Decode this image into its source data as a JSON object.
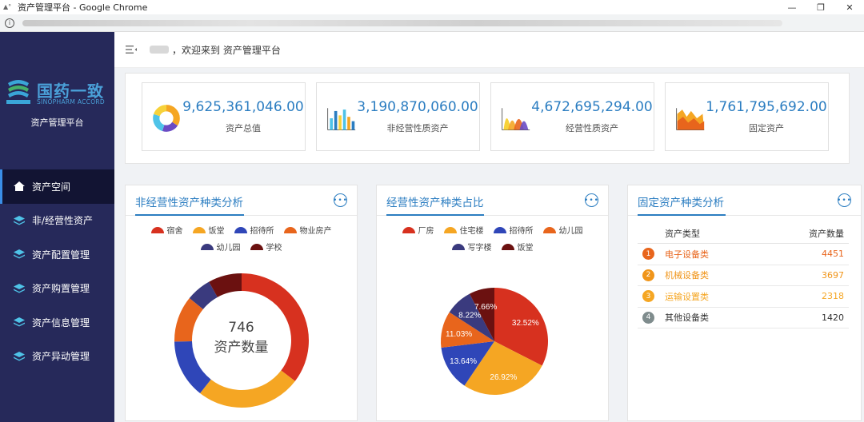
{
  "window": {
    "title": "资产管理平台 - Google Chrome",
    "minimize": "—",
    "restore": "❐",
    "close": "✕"
  },
  "header": {
    "welcome": "，欢迎来到 资产管理平台"
  },
  "brand": {
    "logo_cn": "国药一致",
    "logo_en": "SINOPHARM ACCORD",
    "platform_title": "资产管理平台"
  },
  "sidebar": {
    "items": [
      {
        "label": "资产空间",
        "icon": "home-icon",
        "active": true
      },
      {
        "label": "非/经营性资产",
        "icon": "stack-icon"
      },
      {
        "label": "资产配置管理",
        "icon": "stack-icon"
      },
      {
        "label": "资产购置管理",
        "icon": "stack-icon"
      },
      {
        "label": "资产信息管理",
        "icon": "stack-icon"
      },
      {
        "label": "资产异动管理",
        "icon": "stack-icon"
      }
    ]
  },
  "stats": [
    {
      "value": "9,625,361,046.00",
      "label": "资产总值",
      "icon": "donut-chart-icon"
    },
    {
      "value": "3,190,870,060.00",
      "label": "非经营性质资产",
      "icon": "bar-chart-icon"
    },
    {
      "value": "4,672,695,294.00",
      "label": "经营性质资产",
      "icon": "area-peaks-icon"
    },
    {
      "value": "1,761,795,692.00",
      "label": "固定资产",
      "icon": "mountain-chart-icon"
    }
  ],
  "panels": {
    "non_operating": {
      "title": "非经营性资产种类分析",
      "center_value": "746",
      "center_label": "资产数量"
    },
    "operating": {
      "title": "经营性资产种类占比"
    },
    "fixed": {
      "title": "固定资产种类分析",
      "col_type": "资产类型",
      "col_count": "资产数量"
    }
  },
  "colors": {
    "red": "#d7311f",
    "orange": "#f5a623",
    "blue": "#2f46b8",
    "deep_orange": "#e8651c",
    "indigo": "#3a3a7e",
    "dark_red": "#6b1110",
    "accent": "#2b7dc1",
    "sidebar": "#26295a"
  },
  "fixed_assets_table": [
    {
      "rank": "1",
      "type": "电子设备类",
      "count": "4451",
      "color": "#e8651c",
      "badge": "#e8651c"
    },
    {
      "rank": "2",
      "type": "机械设备类",
      "count": "3697",
      "color": "#f0951a",
      "badge": "#f0951a"
    },
    {
      "rank": "3",
      "type": "运输设置类",
      "count": "2318",
      "color": "#f5a623",
      "badge": "#f5a623"
    },
    {
      "rank": "4",
      "type": "其他设备类",
      "count": "1420",
      "color": "#333333",
      "badge": "#7f8c8d"
    }
  ],
  "chart_data": [
    {
      "type": "pie",
      "variant": "donut",
      "legend": [
        "宿舍",
        "饭堂",
        "招待所",
        "物业房产",
        "幼儿园",
        "学校"
      ],
      "values": [
        35,
        25,
        14,
        11,
        6,
        8
      ],
      "colors": [
        "#d7311f",
        "#f5a623",
        "#2f46b8",
        "#e8651c",
        "#3a3a7e",
        "#6b1110"
      ]
    },
    {
      "type": "pie",
      "legend": [
        "厂房",
        "住宅楼",
        "招待所",
        "幼儿园",
        "写字楼",
        "饭堂"
      ],
      "values": [
        32.52,
        26.92,
        13.64,
        11.03,
        8.22,
        7.66
      ],
      "labels": [
        "32.52%",
        "26.92%",
        "13.64%",
        "11.03%",
        "8.22%",
        "7.66%"
      ],
      "colors": [
        "#d7311f",
        "#f5a623",
        "#2f46b8",
        "#e8651c",
        "#3a3a7e",
        "#6b1110"
      ]
    }
  ]
}
